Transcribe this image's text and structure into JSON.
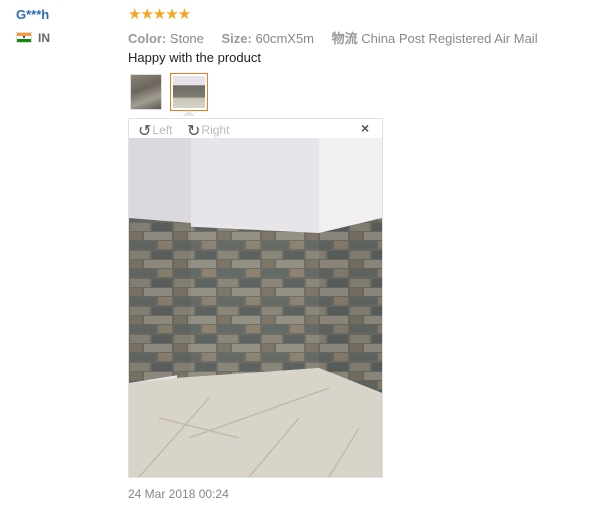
{
  "reviewer": {
    "name": "G***h",
    "country": "IN",
    "flag_icon": "india-flag-icon"
  },
  "rating": {
    "stars": 5,
    "star_glyphs": "★★★★★",
    "color": "#f5a623"
  },
  "attributes": [
    {
      "key": "Color:",
      "value": "Stone"
    },
    {
      "key": "Size:",
      "value": "60cmX5m"
    },
    {
      "key": "物流",
      "value": "China Post Registered Air Mail"
    }
  ],
  "review_text": "Happy with the product",
  "images": {
    "count": 2,
    "selected_index": 1
  },
  "viewer": {
    "rotate_left_label": "Left",
    "rotate_right_label": "Right",
    "close_glyph": "×"
  },
  "date": "24 Mar 2018 00:24",
  "colors": {
    "accent": "#f07a1a",
    "name_link": "#2d6cb4"
  }
}
